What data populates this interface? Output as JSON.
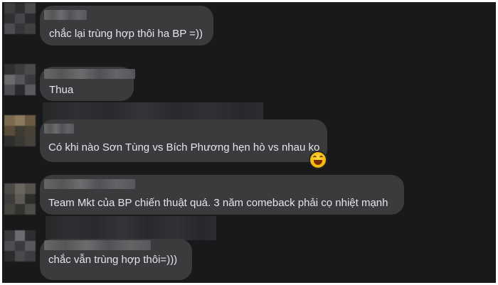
{
  "comments": [
    {
      "text": "chắc lại trùng hợp thôi ha BP =))"
    },
    {
      "text": "Thua"
    },
    {
      "text": "Có khi nào Sơn Tùng vs Bích Phương hẹn hò vs nhau ko",
      "reaction": "grinning-emoji"
    },
    {
      "text": "Team Mkt của BP chiến thuật quá. 3 năm comeback phải cọ nhiệt mạnh"
    },
    {
      "text": "chắc vẫn trùng hợp thôi=)))"
    }
  ]
}
